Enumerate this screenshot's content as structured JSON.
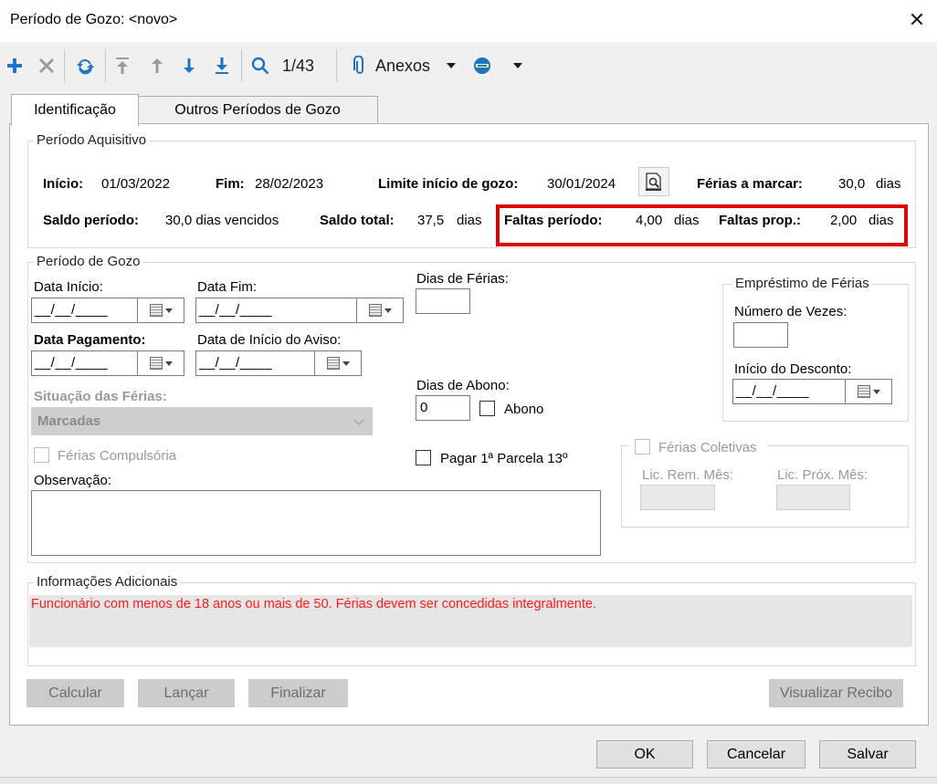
{
  "window": {
    "title": "Período de Gozo: <novo>"
  },
  "toolbar": {
    "record_counter": "1/43",
    "attachments_label": "Anexos"
  },
  "tabs": [
    {
      "label": "Identificação"
    },
    {
      "label": "Outros Períodos de Gozo"
    }
  ],
  "periodo_aquisitivo": {
    "legend": "Período Aquisitivo",
    "inicio_label": "Início:",
    "inicio_value": "01/03/2022",
    "fim_label": "Fim:",
    "fim_value": "28/02/2023",
    "limite_label": "Limite início de gozo:",
    "limite_value": "30/01/2024",
    "ferias_marcar_label": "Férias a marcar:",
    "ferias_marcar_value": "30,0",
    "ferias_marcar_unit": "dias",
    "saldo_periodo_label": "Saldo período:",
    "saldo_periodo_value": "30,0 dias vencidos",
    "saldo_total_label": "Saldo total:",
    "saldo_total_value": "37,5",
    "saldo_total_unit": "dias",
    "faltas_periodo_label": "Faltas período:",
    "faltas_periodo_value": "4,00",
    "faltas_periodo_unit": "dias",
    "faltas_prop_label": "Faltas prop.:",
    "faltas_prop_value": "2,00",
    "faltas_prop_unit": "dias"
  },
  "periodo_gozo": {
    "legend": "Período de Gozo",
    "data_inicio_label": "Data Início:",
    "data_inicio_value": "__/__/____",
    "data_fim_label": "Data Fim:",
    "data_fim_value": "__/__/____",
    "dias_ferias_label": "Dias de Férias:",
    "dias_ferias_value": "",
    "data_pagamento_label": "Data Pagamento:",
    "data_pagamento_value": "__/__/____",
    "data_aviso_label": "Data de Início do Aviso:",
    "data_aviso_value": "__/__/____",
    "dias_abono_label": "Dias de Abono:",
    "dias_abono_value": "0",
    "abono_label": "Abono",
    "situacao_label": "Situação das Férias:",
    "situacao_value": "Marcadas",
    "compulsoria_label": "Férias Compulsória",
    "pagar_parcela_label": "Pagar 1ª Parcela 13º",
    "observacao_label": "Observação:"
  },
  "emprestimo": {
    "legend": "Empréstimo de Férias",
    "num_vezes_label": "Número de Vezes:",
    "num_vezes_value": "",
    "inicio_desconto_label": "Início do Desconto:",
    "inicio_desconto_value": "__/__/____"
  },
  "ferias_coletivas": {
    "legend": "Férias Coletivas",
    "lic_rem_label": "Lic. Rem. Mês:",
    "lic_prox_label": "Lic. Próx. Mês:"
  },
  "info_adicionais": {
    "legend": "Informações Adicionais",
    "message": "Funcionário com menos de 18 anos ou mais de 50. Férias devem ser concedidas integralmente."
  },
  "actions": {
    "calcular": "Calcular",
    "lancar": "Lançar",
    "finalizar": "Finalizar",
    "visualizar": "Visualizar Recibo"
  },
  "dialog": {
    "ok": "OK",
    "cancelar": "Cancelar",
    "salvar": "Salvar"
  },
  "colors": {
    "accent": "#1f73c5",
    "highlight": "#e00000",
    "warning_text": "#ff1a1a"
  }
}
